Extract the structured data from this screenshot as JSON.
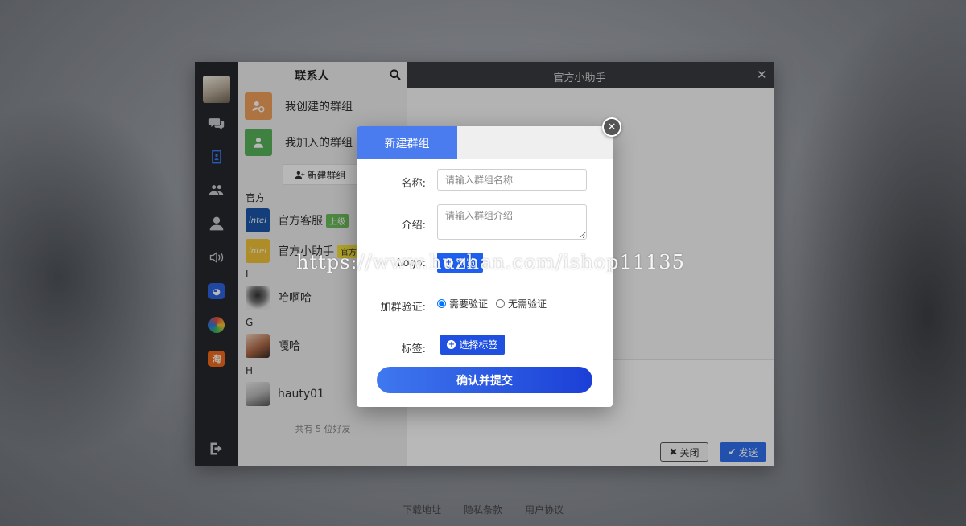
{
  "contacts_panel": {
    "title": "联系人",
    "groups": [
      {
        "label": "我创建的群组",
        "color": "#f0a15b"
      },
      {
        "label": "我加入的群组",
        "color": "#56b35a"
      }
    ],
    "new_group_button": "新建群组",
    "sections": [
      {
        "letter": "官方",
        "contacts": [
          {
            "name": "官方客服",
            "tag": "上级",
            "tag_bg": "#6dbb5a",
            "tag_color": "#ffffff"
          },
          {
            "name": "官方小助手",
            "tag": "官方",
            "tag_bg": "#f5e23a",
            "tag_color": "#333333"
          }
        ]
      },
      {
        "letter": "I",
        "contacts": [
          {
            "name": "哈啊哈"
          }
        ]
      },
      {
        "letter": "G",
        "contacts": [
          {
            "name": "嘎哈"
          }
        ]
      },
      {
        "letter": "H",
        "contacts": [
          {
            "name": "hauty01"
          }
        ]
      }
    ],
    "friend_count": "共有 5 位好友"
  },
  "chat": {
    "title": "官方小助手",
    "close_label": "关闭",
    "send_label": "发送"
  },
  "modal": {
    "tab_active": "新建群组",
    "name_label": "名称:",
    "name_placeholder": "请输入群组名称",
    "intro_label": "介绍:",
    "intro_placeholder": "请输入群组介绍",
    "logo_label": "Logo:",
    "browse_label": "浏览",
    "verify_label": "加群验证:",
    "verify_options": [
      "需要验证",
      "无需验证"
    ],
    "verify_selected": "需要验证",
    "tag_label": "标签:",
    "tag_button": "选择标签",
    "submit": "确认并提交"
  },
  "watermark": "https://www.huzhan.com/ishop11135",
  "footer": [
    "下载地址",
    "隐私条款",
    "用户协议"
  ],
  "colors": {
    "accent": "#2f6ff0",
    "rail": "#25272c"
  }
}
